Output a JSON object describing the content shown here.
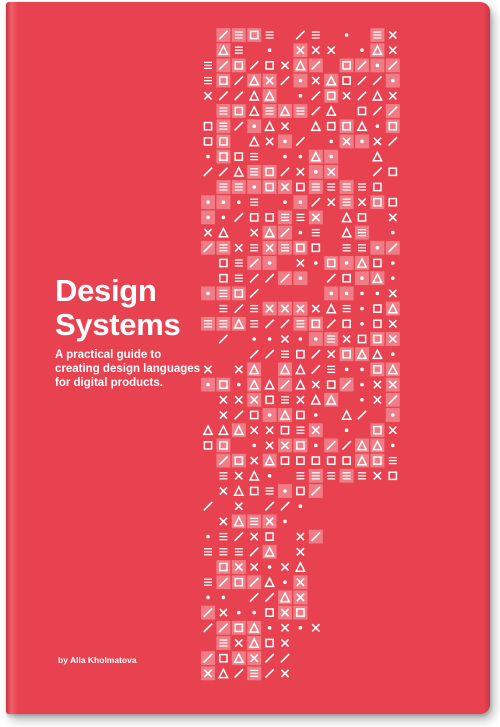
{
  "book": {
    "title_lines": [
      "Design",
      "Systems"
    ],
    "subtitle": "A practical guide to creating design languages for digital products.",
    "author": "by Alla Kholmatova"
  },
  "colors": {
    "cover": "#e8414f",
    "tile": "#f07c86",
    "glyph": "#ffffff"
  },
  "icons": [
    "dot-icon",
    "slash-icon",
    "triangle-icon",
    "square-icon",
    "cross-icon",
    "lines-icon"
  ]
}
